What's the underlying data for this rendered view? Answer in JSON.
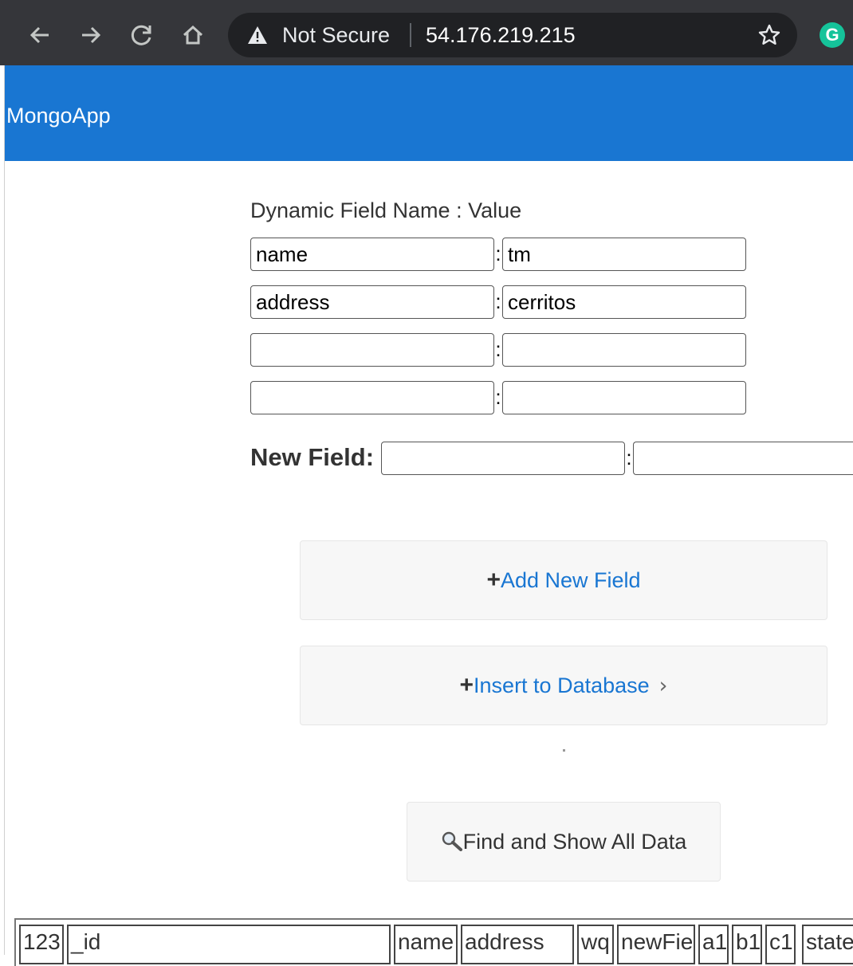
{
  "browser": {
    "security_label": "Not Secure",
    "url": "54.176.219.215",
    "extension_letter": "G"
  },
  "app": {
    "brand": "MongoApp"
  },
  "form": {
    "heading": "Dynamic Field Name : Value",
    "colon": ":",
    "rows": [
      {
        "name": "name",
        "value": "tm"
      },
      {
        "name": "address",
        "value": "cerritos"
      },
      {
        "name": "",
        "value": ""
      },
      {
        "name": "",
        "value": ""
      }
    ],
    "new_field_label": "New Field:",
    "new_field_name": "",
    "new_field_value": ""
  },
  "buttons": {
    "add_plus": "+",
    "add_label": "Add New Field",
    "insert_plus": "+",
    "insert_label": "Insert to Database",
    "insert_chevron": "›",
    "find_icon": "🔍",
    "find_label": "Find and Show All Data"
  },
  "table": {
    "headers": [
      "123",
      "_id",
      "name",
      "address",
      "wq",
      "newFie",
      "a1",
      "b1",
      "c1",
      "state"
    ]
  },
  "icons": {
    "back": "back-arrow-icon",
    "forward": "forward-arrow-icon",
    "reload": "reload-icon",
    "home": "home-icon",
    "warning": "warning-triangle-icon",
    "bookmark": "star-icon",
    "extension": "grammarly-icon",
    "search": "magnifier-icon"
  },
  "colors": {
    "appbar": "#1976d2",
    "chrome": "#35363a",
    "omnibox": "#202124",
    "link_blue": "#1976d2"
  }
}
